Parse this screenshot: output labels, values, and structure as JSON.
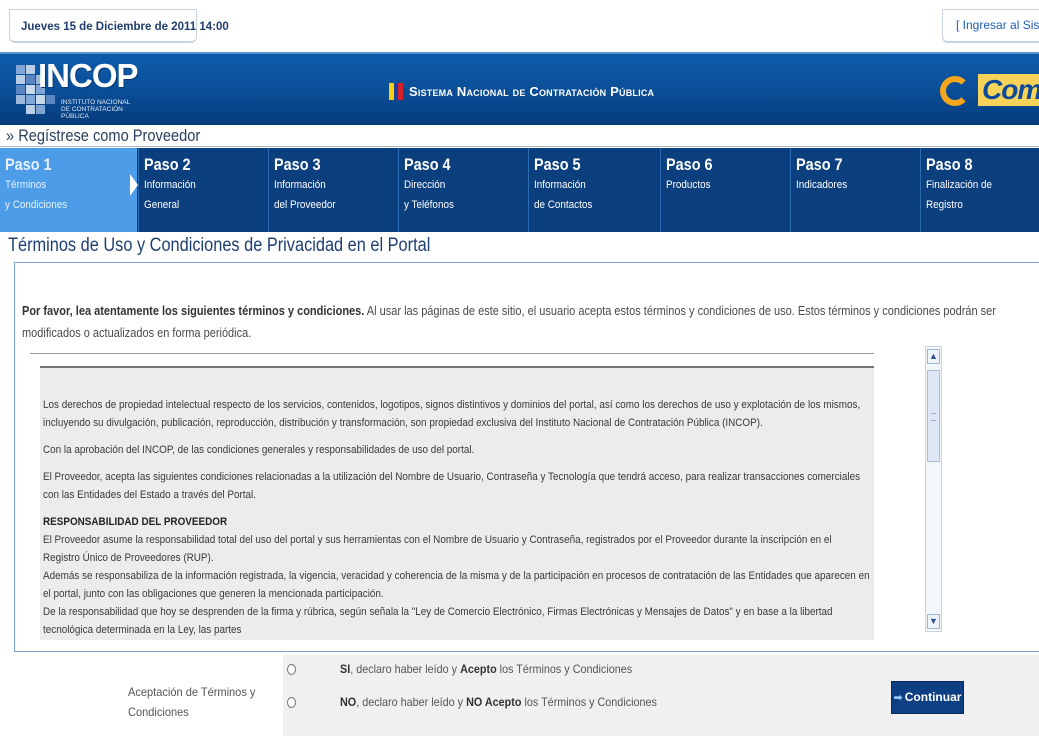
{
  "topbar": {
    "date": "Jueves 15 de Diciembre de 2011 14:00",
    "login_link": "[ Ingresar al Sistema ]"
  },
  "header": {
    "incop_logo_text": "INCOP",
    "incop_logo_subtitle": "INSTITUTO NACIONAL DE CONTRATACIÓN PÚBLICA",
    "title": "Sistema Nacional de Contratación Pública",
    "compras_logo_text": "Compras",
    "flag_colors": [
      "#f5d20a",
      "#1d3f9b",
      "#d6202a"
    ]
  },
  "register": {
    "title": "» Regístrese como Proveedor"
  },
  "steps": [
    {
      "num": "Paso 1",
      "line1": "Términos",
      "line2": "y Condiciones"
    },
    {
      "num": "Paso 2",
      "line1": "Información",
      "line2": "General"
    },
    {
      "num": "Paso 3",
      "line1": "Información",
      "line2": "del Proveedor"
    },
    {
      "num": "Paso 4",
      "line1": "Dirección",
      "line2": "y Teléfonos"
    },
    {
      "num": "Paso 5",
      "line1": "Información",
      "line2": "de Contactos"
    },
    {
      "num": "Paso 6",
      "line1": "Productos",
      "line2": ""
    },
    {
      "num": "Paso 7",
      "line1": "Indicadores",
      "line2": ""
    },
    {
      "num": "Paso 8",
      "line1": "Finalización de",
      "line2": "Registro"
    }
  ],
  "page": {
    "title": "Términos de Uso y Condiciones de Privacidad en el Portal",
    "intro_bold": "Por favor, lea atentamente los siguientes términos y condiciones.",
    "intro_rest": " Al usar las páginas de este sitio, el usuario acepta estos términos y condiciones de uso. Estos términos y condiciones podrán ser modificados o actualizados en forma periódica."
  },
  "terms": {
    "p1": "Los derechos de propiedad intelectual respecto de los servicios, contenidos, logotipos, signos distintivos y dominios del portal, así como los derechos de uso y explotación de los mismos, incluyendo su divulgación, publicación, reproducción, distribución y transformación, son propiedad exclusiva del Instituto Nacional de Contratación Pública (INCOP).",
    "p2": "Con la aprobación del INCOP, de las condiciones generales y responsabilidades de uso del portal.",
    "p3": "El Proveedor, acepta las siguientes condiciones relacionadas a la utilización del Nombre de Usuario, Contraseña y Tecnología que tendrá acceso, para realizar transacciones comerciales con las Entidades del Estado a través del Portal.",
    "heading": "RESPONSABILIDAD DEL PROVEEDOR",
    "p4": "El Proveedor asume la responsabilidad total del uso del portal y sus herramientas con el Nombre de Usuario y Contraseña, registrados por el Proveedor durante la inscripción en el Registro Único de Proveedores (RUP).",
    "p5": "Además se responsabiliza de la información registrada, la vigencia, veracidad y coherencia de la misma y de la participación en procesos de contratación de las Entidades que aparecen en el portal, junto con las obligaciones que generen la mencionada participación.",
    "p6": "De la responsabilidad que hoy se desprenden de la firma y rúbrica, según señala la \"Ley de Comercio Electrónico, Firmas Electrónicas y Mensajes de Datos\" y en base a la libertad tecnológica determinada en la Ley, las partes"
  },
  "acceptance": {
    "label": "Aceptación de Términos y Condiciones",
    "yes_bold": "SI",
    "yes_mid": ", declaro haber leído y ",
    "yes_bold2": "Acepto",
    "yes_end": " los Términos y Condiciones",
    "no_bold": "NO",
    "no_mid": ", declaro haber leído y ",
    "no_bold2": "NO Acepto",
    "no_end": " los Términos y Condiciones",
    "continue_label": "Continuar"
  }
}
